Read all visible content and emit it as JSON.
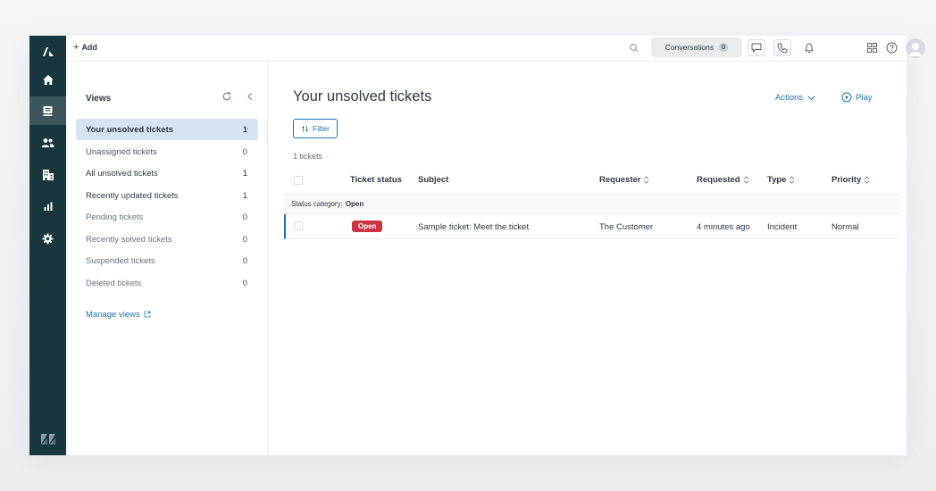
{
  "colors": {
    "rail_bg": "#17373f",
    "rail_active": "#3a565c",
    "accent": "#1f73b7",
    "view_active_bg": "#d6e4f1",
    "status_open": "#cc3340"
  },
  "rail": {
    "items": [
      {
        "name": "home-icon"
      },
      {
        "name": "views-icon",
        "active": true
      },
      {
        "name": "customers-icon"
      },
      {
        "name": "organizations-icon"
      },
      {
        "name": "reporting-icon"
      },
      {
        "name": "admin-gear-icon"
      }
    ]
  },
  "topbar": {
    "add_label": "Add",
    "conversations_label": "Conversations",
    "conversations_count": "0"
  },
  "views": {
    "title": "Views",
    "items": [
      {
        "label": "Your unsolved tickets",
        "count": "1",
        "active": true
      },
      {
        "label": "Unassigned tickets",
        "count": "0"
      },
      {
        "label": "All unsolved tickets",
        "count": "1"
      },
      {
        "label": "Recently updated tickets",
        "count": "1"
      },
      {
        "label": "Pending tickets",
        "count": "0"
      },
      {
        "label": "Recently solved tickets",
        "count": "0"
      },
      {
        "label": "Suspended tickets",
        "count": "0"
      },
      {
        "label": "Deleted tickets",
        "count": "0"
      }
    ],
    "manage_label": "Manage views"
  },
  "main": {
    "title": "Your unsolved tickets",
    "actions_label": "Actions",
    "play_label": "Play",
    "filter_label": "Filter",
    "ticket_count": "1 tickets",
    "columns": {
      "status": "Ticket status",
      "subject": "Subject",
      "requester": "Requester",
      "requested": "Requested",
      "type": "Type",
      "priority": "Priority"
    },
    "group": {
      "prefix": "Status category:",
      "value": "Open"
    },
    "rows": [
      {
        "status": "Open",
        "subject": "Sample ticket: Meet the ticket",
        "requester": "The Customer",
        "requested": "4 minutes ago",
        "type": "Incident",
        "priority": "Normal"
      }
    ]
  }
}
